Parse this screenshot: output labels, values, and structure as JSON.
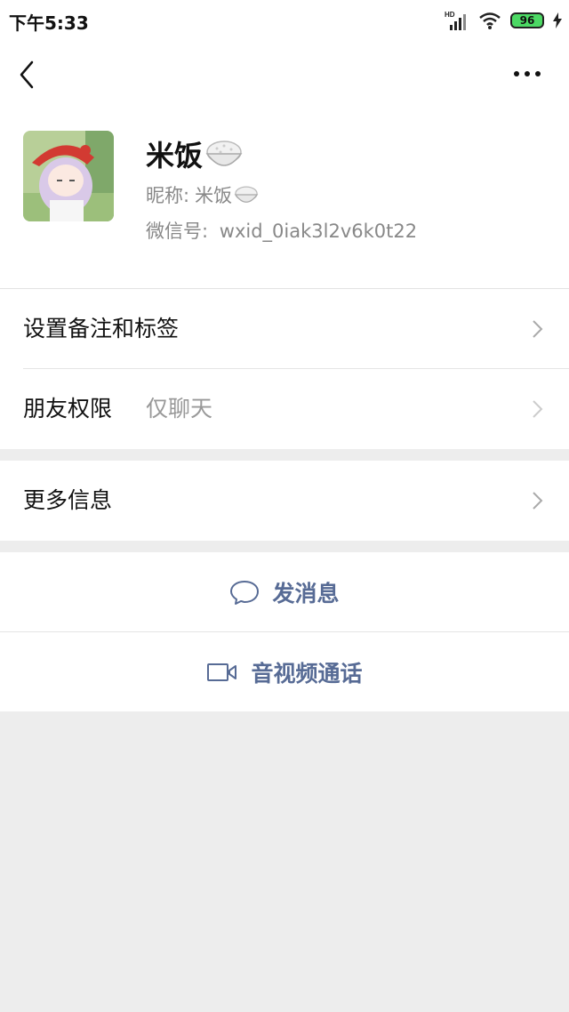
{
  "status_bar": {
    "time": "下午5:33",
    "network_label": "HD",
    "battery": "96",
    "colors": {
      "battery_fill": "#4cd964"
    }
  },
  "navbar": {
    "back_icon": "chevron-left-icon",
    "more_icon": "more-dots-icon"
  },
  "profile": {
    "display_name": "米饭",
    "nickname_label": "昵称:",
    "nickname": "米饭",
    "wechat_id_label": "微信号:",
    "wechat_id": "wxid_0iak3l2v6k0t22",
    "emoji_icon": "rice-bowl-icon"
  },
  "menu": {
    "remarks_tags": "设置备注和标签",
    "friend_permissions": "朋友权限",
    "friend_permissions_value": "仅聊天",
    "more_info": "更多信息"
  },
  "actions": {
    "send_message": "发消息",
    "send_message_icon": "chat-bubble-icon",
    "video_call": "音视频通话",
    "video_call_icon": "video-camera-icon"
  },
  "colors": {
    "link_blue": "#576b95",
    "background": "#ededed"
  }
}
